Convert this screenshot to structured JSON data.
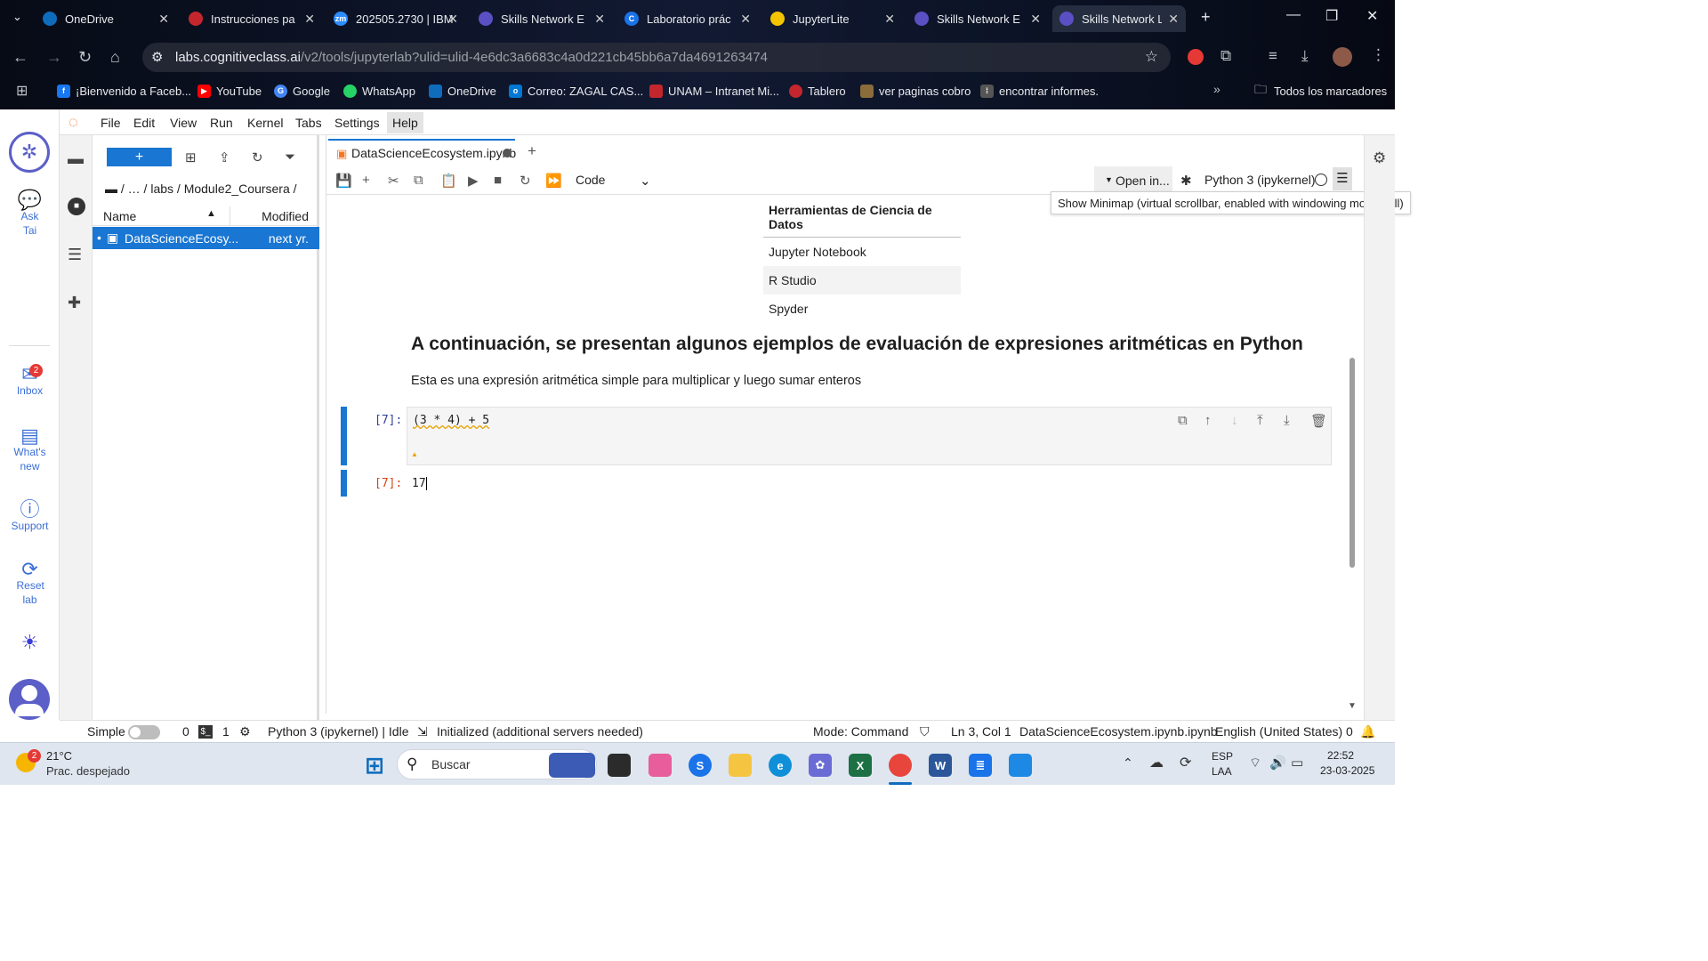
{
  "browser": {
    "tabs": [
      {
        "title": "OneDrive",
        "color": "#0f6cbd"
      },
      {
        "title": "Instrucciones pa",
        "color": "#c4262e"
      },
      {
        "title": "202505.2730 | IBM",
        "color": "#2d8cff"
      },
      {
        "title": "Skills Network E",
        "color": "#5b4fc4"
      },
      {
        "title": "Laboratorio prác",
        "color": "#1a73e8"
      },
      {
        "title": "JupyterLite",
        "color": "#f5c400"
      },
      {
        "title": "Skills Network E",
        "color": "#5b4fc4"
      },
      {
        "title": "Skills Network L",
        "color": "#5b4fc4"
      }
    ],
    "url_host": "labs.cognitiveclass.ai",
    "url_path": "/v2/tools/jupyterlab?ulid=ulid-4e6dc3a6683c4a0d221cb45bb6a7da4691263474",
    "bookmarks": [
      {
        "label": "¡Bienvenido a Faceb...",
        "color": "#1877f2"
      },
      {
        "label": "YouTube",
        "color": "#ff0000"
      },
      {
        "label": "Google",
        "color": "#4285f4"
      },
      {
        "label": "WhatsApp",
        "color": "#25d366"
      },
      {
        "label": "OneDrive",
        "color": "#0f6cbd"
      },
      {
        "label": "Correo: ZAGAL CAS...",
        "color": "#0078d4"
      },
      {
        "label": "UNAM – Intranet Mi...",
        "color": "#c4262e"
      },
      {
        "label": "Tablero",
        "color": "#c4262e"
      },
      {
        "label": "ver paginas cobro",
        "color": "#8a6d3b"
      },
      {
        "label": "encontrar informes.",
        "color": "#555555"
      }
    ],
    "all_bookmarks": "Todos los marcadores"
  },
  "rail": {
    "ask": "Ask Tai",
    "inbox": "Inbox",
    "inbox_badge": "2",
    "whats_new": "What's new",
    "support": "Support",
    "reset": "Reset lab"
  },
  "menubar": [
    "File",
    "Edit",
    "View",
    "Run",
    "Kernel",
    "Tabs",
    "Settings",
    "Help"
  ],
  "filebrowser": {
    "breadcrumb": "/  …  / labs / Module2_Coursera /",
    "col_name": "Name",
    "col_modified": "Modified",
    "files": [
      {
        "name": "DataScienceEcosy...",
        "modified": "next yr."
      }
    ]
  },
  "notebook": {
    "tab_title": "DataScienceEcosystem.ipynb",
    "cell_type": "Code",
    "open_in": "Open in...",
    "kernel": "Python 3 (ipykernel)",
    "tooltip": "Show Minimap (virtual scrollbar, enabled with windowing mode: full)",
    "table_header": "Herramientas de Ciencia de Datos",
    "table_rows": [
      "Jupyter Notebook",
      "R Studio",
      "Spyder"
    ],
    "heading": "A continuación, se presentan algunos ejemplos de evaluación de expresiones aritméticas en Python",
    "paragraph": "Esta es una expresión aritmética simple para multiplicar y luego sumar enteros",
    "in_prompt": "[7]:",
    "code": "(3 * 4) + 5",
    "out_prompt": "[7]:",
    "output": "17"
  },
  "statusbar": {
    "simple": "Simple",
    "terminals": "0",
    "kernels": "1",
    "kernel_status": "Python 3 (ipykernel) | Idle",
    "lsp": "Initialized (additional servers needed)",
    "mode": "Mode: Command",
    "cursor": "Ln 3, Col 1",
    "file": "DataScienceEcosystem.ipynb.ipynb",
    "language": "English (United States)",
    "notifications": "0"
  },
  "taskbar": {
    "weather_temp": "21°C",
    "weather_desc": "Prac. despejado",
    "weather_badge": "2",
    "search": "Buscar",
    "lang": "ESP",
    "lang2": "LAA",
    "time": "22:52",
    "date": "23-03-2025"
  }
}
